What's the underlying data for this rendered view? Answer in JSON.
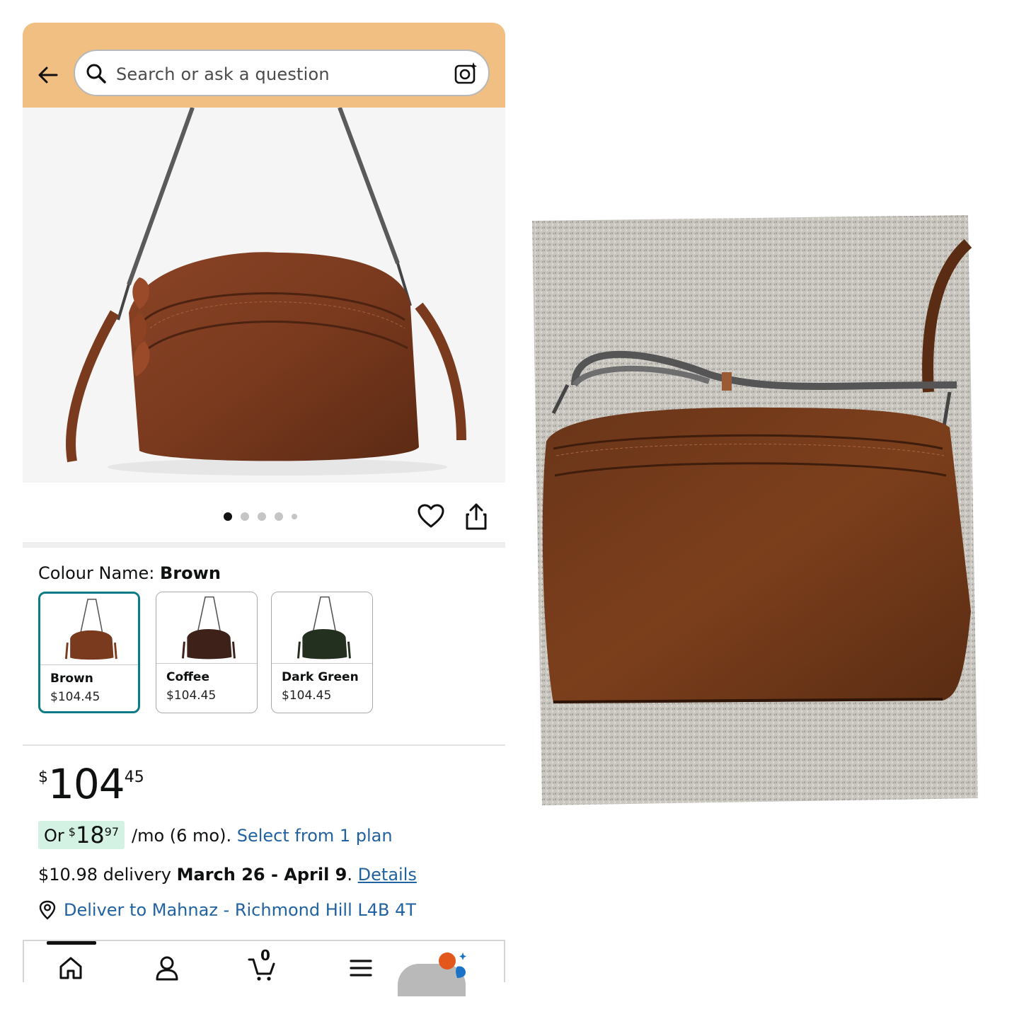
{
  "search": {
    "placeholder": "Search or ask a question"
  },
  "gallery": {
    "image_count": 5,
    "active_index": 0
  },
  "colour": {
    "label": "Colour Name:",
    "selected": "Brown",
    "options": [
      {
        "name": "Brown",
        "price": "$104.45"
      },
      {
        "name": "Coffee",
        "price": "$104.45"
      },
      {
        "name": "Dark Green",
        "price": "$104.45"
      }
    ]
  },
  "price": {
    "currency": "$",
    "whole": "104",
    "fraction": "45"
  },
  "installment": {
    "prefix": "Or",
    "currency": "$",
    "whole": "18",
    "fraction": "97",
    "suffix": "/mo (6 mo).",
    "link": "Select from 1 plan"
  },
  "delivery": {
    "cost_text": "$10.98 delivery",
    "dates": "March 26 - April 9",
    "period": ".",
    "details_link": "Details"
  },
  "deliver_to": {
    "text": "Deliver to Mahnaz - Richmond Hill L4B 4T"
  },
  "bottom_nav": {
    "cart_count": "0"
  },
  "colors": {
    "header_bg": "#f2bf82",
    "link": "#2162a1",
    "selected_swatch_border": "#0e7c86",
    "installment_bg": "#d4f2e4",
    "leather_brown": "#7a3a1e"
  }
}
